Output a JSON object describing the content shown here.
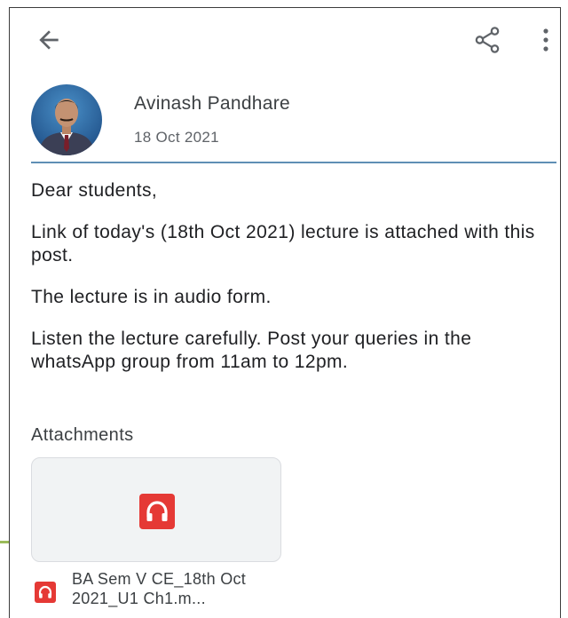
{
  "topbar": {
    "back_icon": "arrow-back-icon",
    "share_icon": "share-icon",
    "more_icon": "more-vertical-icon"
  },
  "post": {
    "author_name": "Avinash Pandhare",
    "date": "18 Oct 2021",
    "paragraphs": [
      "Dear students,",
      "Link of today's (18th Oct 2021) lecture is attached with this post.",
      "The lecture is in audio form.",
      "Listen the lecture carefully. Post your queries in the whatsApp group from 11am to 12pm."
    ]
  },
  "attachments": {
    "label": "Attachments",
    "items": [
      {
        "name": "BA Sem V CE_18th Oct 2021_U1 Ch1.m...",
        "icon": "headphones-icon"
      }
    ]
  },
  "colors": {
    "divider": "#5f8fb5",
    "audio_icon_bg": "#e53935",
    "card_bg": "#f1f3f4"
  }
}
